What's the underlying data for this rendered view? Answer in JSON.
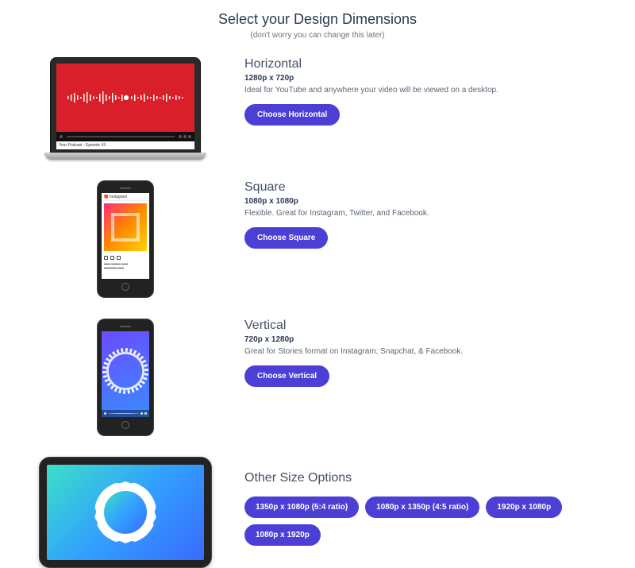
{
  "header": {
    "title": "Select your Design Dimensions",
    "subtitle": "(don't worry you can change this later)"
  },
  "options": [
    {
      "title": "Horizontal",
      "dimensions": "1280p x 720p",
      "description": "Ideal for YouTube and anywhere your video will be viewed on a desktop.",
      "button": "Choose Horizontal",
      "preview_caption": "Your Podcast - Episode #3"
    },
    {
      "title": "Square",
      "dimensions": "1080p x 1080p",
      "description": "Flexible. Great for Instagram, Twitter, and Facebook.",
      "button": "Choose Square",
      "preview_app": "Instagram"
    },
    {
      "title": "Vertical",
      "dimensions": "720p x 1280p",
      "description": "Great for Stories format on Instagram, Snapchat, & Facebook.",
      "button": "Choose Vertical"
    }
  ],
  "other": {
    "title": "Other Size Options",
    "buttons": [
      "1350p x 1080p (5:4 ratio)",
      "1080p x 1350p (4:5 ratio)",
      "1920p x 1080p",
      "1080p x 1920p"
    ]
  }
}
